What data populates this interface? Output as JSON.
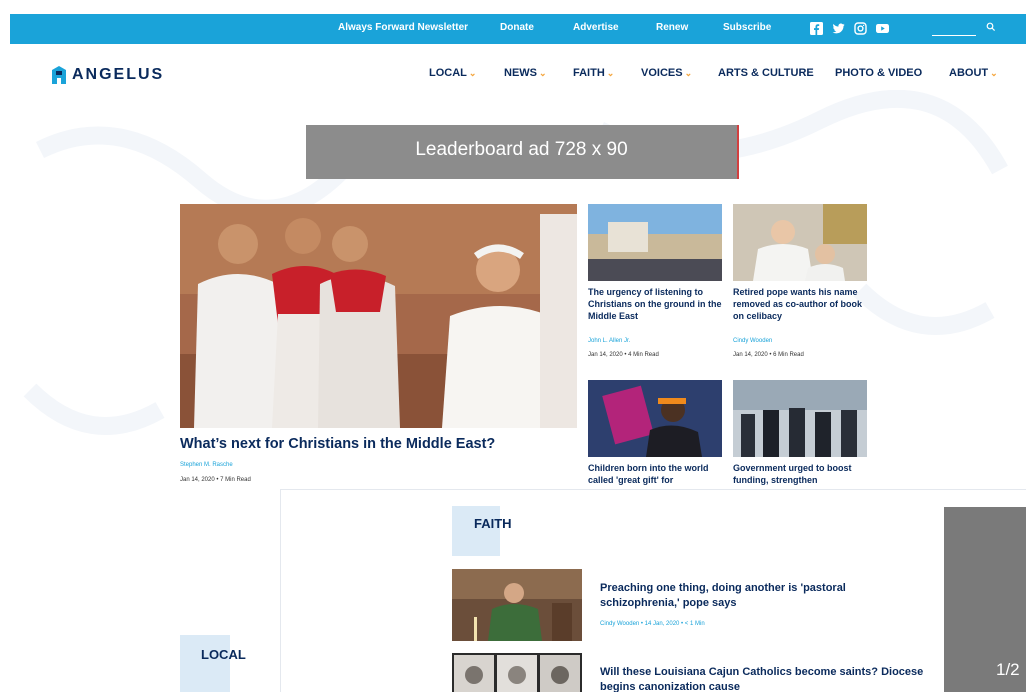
{
  "topbar": {
    "links": [
      "Always Forward Newsletter",
      "Donate",
      "Advertise",
      "Renew",
      "Subscribe"
    ],
    "social_icons": [
      "facebook-icon",
      "twitter-icon",
      "instagram-icon",
      "youtube-icon"
    ],
    "search_icon": "search-icon",
    "color": "#1aa3d9"
  },
  "brand": {
    "name": "ANGELUS"
  },
  "nav": {
    "items": [
      "LOCAL",
      "NEWS",
      "FAITH",
      "VOICES",
      "ARTS & CULTURE",
      "PHOTO & VIDEO",
      "ABOUT"
    ]
  },
  "ad": {
    "label": "Leaderboard ad  728 x 90"
  },
  "hero": {
    "title": "What’s next for Christians in the Middle East?",
    "author": "Stephen M. Rasche",
    "meta": "Jan 14, 2020 • 7 Min Read"
  },
  "cards": [
    {
      "title": "The urgency of listening to Christians on the ground in the Middle East",
      "author": "John L. Allen Jr.",
      "meta": "Jan 14, 2020 • 4 Min Read"
    },
    {
      "title": "Retired pope wants his name removed as co-author of book on celibacy",
      "author": "Cindy Wooden",
      "meta": "Jan 14, 2020 • 6 Min Read"
    },
    {
      "title": "Children born into the world called 'great gift' for",
      "author": "",
      "meta": ""
    },
    {
      "title": "Government urged to boost funding, strengthen",
      "author": "",
      "meta": ""
    }
  ],
  "panel": {
    "section_faith": "FAITH",
    "section_local": "LOCAL",
    "articles": [
      {
        "title": "Preaching one thing, doing another is 'pastoral schizophrenia,' pope says",
        "meta": "Cindy Wooden  •  14 Jan, 2020  •  < 1 Min"
      },
      {
        "title": "Will these Louisiana Cajun Catholics become saints? Diocese begins canonization cause",
        "meta": ""
      }
    ],
    "pager": "1/2"
  }
}
